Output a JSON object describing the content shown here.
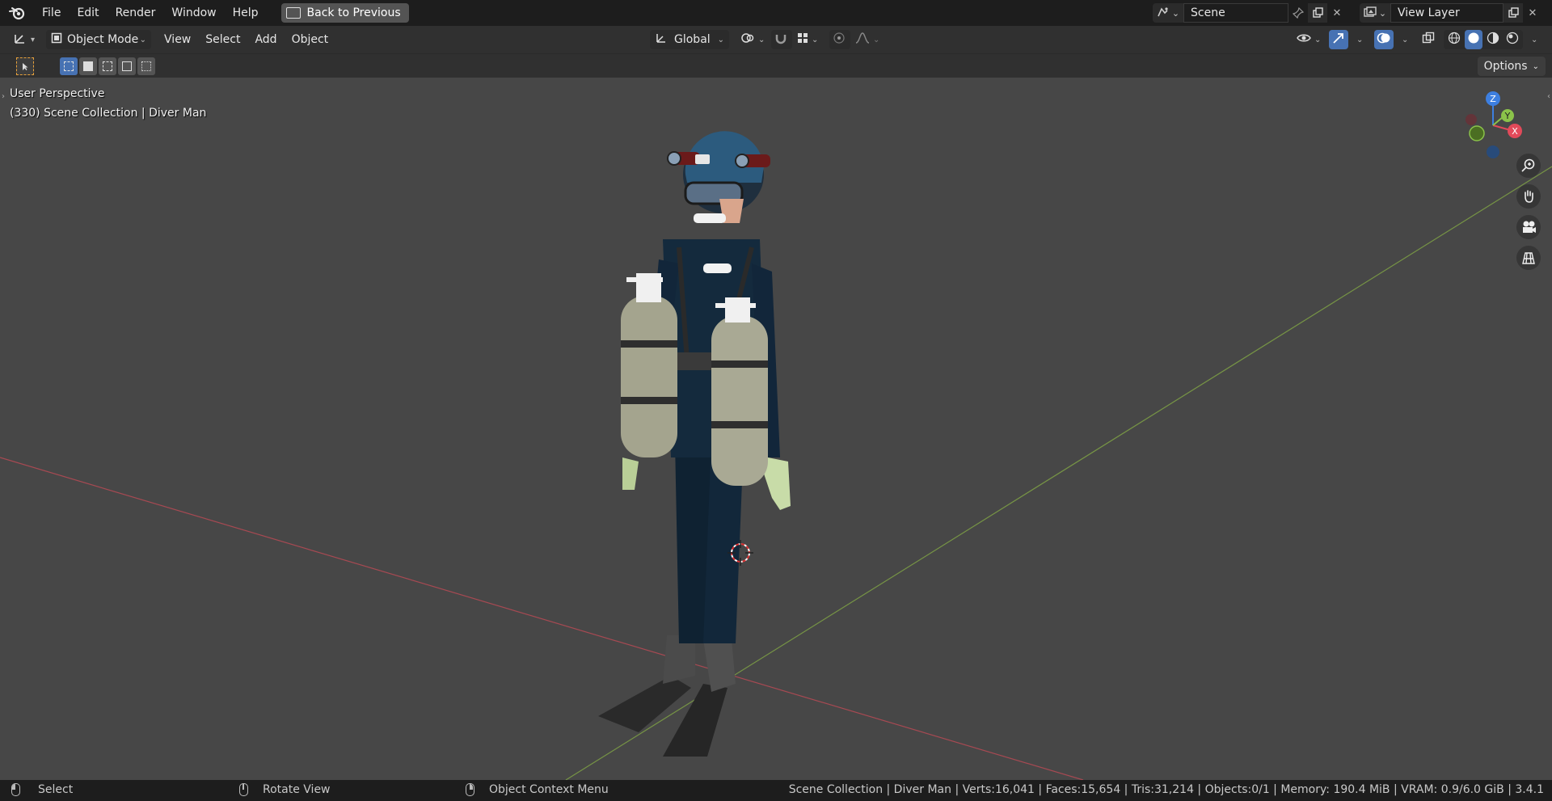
{
  "menubar": {
    "items": [
      "File",
      "Edit",
      "Render",
      "Window",
      "Help"
    ],
    "back_button": "Back to Previous",
    "scene": "Scene",
    "view_layer": "View Layer"
  },
  "header": {
    "mode": "Object Mode",
    "menus": [
      "View",
      "Select",
      "Add",
      "Object"
    ],
    "transform_orientation": "Global"
  },
  "toolsettings": {
    "options_label": "Options"
  },
  "viewport": {
    "view_name": "User Perspective",
    "collection_info": "(330) Scene Collection | Diver Man",
    "gizmo": {
      "x": "X",
      "y": "Y",
      "z": "Z"
    }
  },
  "statusbar": {
    "left_click": "Select",
    "middle_click": "Rotate View",
    "right_click": "Object Context Menu",
    "stats": "Scene Collection | Diver Man  | Verts:16,041 | Faces:15,654 | Tris:31,214 | Objects:0/1 | Memory: 190.4 MiB | VRAM: 0.9/6.0 GiB | 3.4.1"
  },
  "colors": {
    "accent": "#4772b3",
    "viewport_bg": "#474747",
    "x_axis": "#e24a5a",
    "y_axis": "#8bc34a",
    "z_axis": "#3d7fe0"
  }
}
